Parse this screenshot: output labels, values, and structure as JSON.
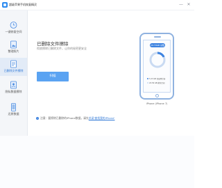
{
  "app": {
    "title": "超级苹果手机恢复精灵"
  },
  "window_controls": {
    "minimize": "—",
    "close": "✕"
  },
  "sidebar": {
    "items": [
      {
        "label": "一键修复空间",
        "icon": "clock-icon",
        "active": false
      },
      {
        "label": "整理照片",
        "icon": "photo-icon",
        "active": false
      },
      {
        "label": "已删除文件擦除",
        "icon": "document-erase-icon",
        "active": true
      },
      {
        "label": "隐私数据擦除",
        "icon": "privacy-icon",
        "active": false
      },
      {
        "label": "还原数据",
        "icon": "phone-data-icon",
        "active": false
      }
    ]
  },
  "main": {
    "title": "已删除文件擦除",
    "subtitle": "彻底擦除已删除文件，让你的秘密更安全",
    "start_button": "扫描"
  },
  "phone": {
    "total_pill": "29.79GB 总数",
    "legend": [
      {
        "label": "5.23 GB 已使用空间",
        "color": "#3c82e0"
      },
      {
        "label": "24.56 GB 剩余空间",
        "color": "#c9daf2"
      }
    ],
    "used_fraction": 0.18,
    "device_label": "iPhone (iPhone 7)"
  },
  "note": {
    "prefix": "注意：要擦除已删除的iPhone数据，请先",
    "link": "关闭'查找我的iPhone'"
  },
  "colors": {
    "accent": "#3c82e0",
    "button": "#5aa3f2",
    "active_nav_bg": "#e2ebf7"
  }
}
